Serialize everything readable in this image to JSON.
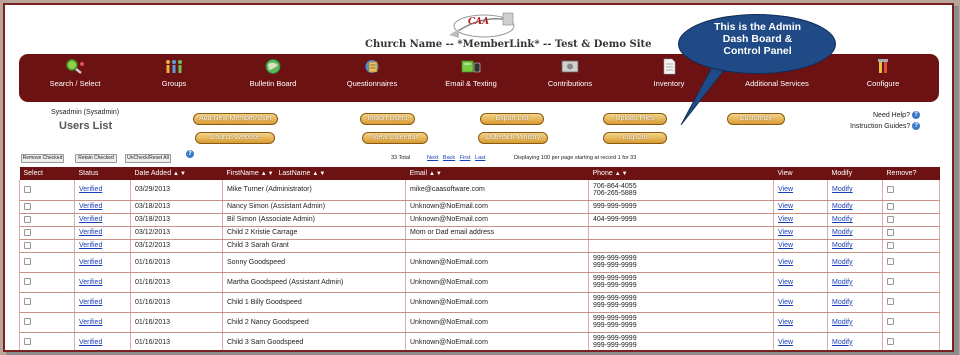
{
  "header": {
    "logo_text": "CAA",
    "site_title": "Church Name -- *MemberLink* -- Test & Demo Site"
  },
  "callout": {
    "line1": "This is the Admin",
    "line2": "Dash Board &",
    "line3": "Control Panel"
  },
  "nav": [
    {
      "label": "Search / Select",
      "icon": "search-icon"
    },
    {
      "label": "Groups",
      "icon": "people-icon"
    },
    {
      "label": "Bulletin Board",
      "icon": "globe-icon"
    },
    {
      "label": "Questionnaires",
      "icon": "clipboard-icon"
    },
    {
      "label": "Email & Texting",
      "icon": "email-icon"
    },
    {
      "label": "Contributions",
      "icon": "money-icon"
    },
    {
      "label": "Inventory",
      "icon": "document-icon"
    },
    {
      "label": "Additional Services",
      "icon": "services-icon"
    },
    {
      "label": "Configure",
      "icon": "tools-icon"
    }
  ],
  "user": {
    "name": "Sysadmin (Sysadmin)",
    "page_title": "Users List"
  },
  "actions": {
    "add_member": "Add New Member/User",
    "import_users": "Import Users",
    "export_list": "Export List",
    "upload_files": "Upload Files",
    "customize": "Customize",
    "church_website": "Church Website",
    "view_calendar": "View Calendar",
    "outreach_ministry": "Outreach Ministry",
    "log_out": "Log Out"
  },
  "help": {
    "need_help": "Need Help?",
    "instruction_guides": "Instruction Guides?"
  },
  "list_controls": {
    "remove_checked": "Remove Checked",
    "retain_checked": "Retain Checked",
    "uncheck_reset": "UnCheck/Reset All",
    "total": "33 Total",
    "next": "Next",
    "back": "Back",
    "first": "First",
    "last": "Last",
    "display_info": "Displaying 100 per page starting at record 1 for 33"
  },
  "table": {
    "headers": {
      "select": "Select",
      "status": "Status",
      "date_added": "Date Added",
      "first_name": "FirstName",
      "last_name": "LastName",
      "email": "Email",
      "phone": "Phone",
      "view": "View",
      "modify": "Modify",
      "remove": "Remove?"
    },
    "rows": [
      {
        "status": "Verified",
        "date": "03/29/2013",
        "name": "Mike Turner (Administrator)",
        "email": "mike@caasoftware.com",
        "phone1": "706-864-4055",
        "phone2": "706-265-5889",
        "view": "View",
        "modify": "Modify"
      },
      {
        "status": "Verified",
        "date": "03/18/2013",
        "name": "Nancy Simon (Assistant Admin)",
        "email": "Unknown@NoEmail.com",
        "phone1": "999-999-9999",
        "phone2": "",
        "view": "View",
        "modify": "Modify"
      },
      {
        "status": "Verified",
        "date": "03/18/2013",
        "name": "Bil Simon (Associate Admin)",
        "email": "Unknown@NoEmail.com",
        "phone1": "404-999-9999",
        "phone2": "",
        "view": "View",
        "modify": "Modify"
      },
      {
        "status": "Verified",
        "date": "03/12/2013",
        "name": "Child 2 Kristie Carrage",
        "email": "Mom or Dad email address",
        "phone1": "",
        "phone2": "",
        "view": "View",
        "modify": "Modify"
      },
      {
        "status": "Verified",
        "date": "03/12/2013",
        "name": "Child 3 Sarah Grant",
        "email": "",
        "phone1": "",
        "phone2": "",
        "view": "View",
        "modify": "Modify"
      },
      {
        "status": "Verified",
        "date": "01/16/2013",
        "name": "Sonny Goodspeed",
        "email": "Unknown@NoEmail.com",
        "phone1": "999-999-9999",
        "phone2": "999-999-9999",
        "view": "View",
        "modify": "Modify"
      },
      {
        "status": "Verified",
        "date": "01/16/2013",
        "name": "Martha Goodspeed (Assistant Admin)",
        "email": "Unknown@NoEmail.com",
        "phone1": "999-999-9999",
        "phone2": "999-999-9999",
        "view": "View",
        "modify": "Modify"
      },
      {
        "status": "Verified",
        "date": "01/16/2013",
        "name": "Child 1 Billy Goodspeed",
        "email": "Unknown@NoEmail.com",
        "phone1": "999-999-9999",
        "phone2": "999-999-9999",
        "view": "View",
        "modify": "Modify"
      },
      {
        "status": "Verified",
        "date": "01/16/2013",
        "name": "Child 2 Nancy Goodspeed",
        "email": "Unknown@NoEmail.com",
        "phone1": "999-999-9999",
        "phone2": "999-999-9999",
        "view": "View",
        "modify": "Modify"
      },
      {
        "status": "Verified",
        "date": "01/16/2013",
        "name": "Child 3 Sam Goodspeed",
        "email": "Unknown@NoEmail.com",
        "phone1": "999-999-9999",
        "phone2": "999-999-9999",
        "view": "View",
        "modify": "Modify"
      }
    ]
  },
  "colors": {
    "brand_dark_red": "#6d1212",
    "button_gold": "#d89b33",
    "link_blue": "#1a3fb5",
    "callout_blue": "#1f4a85"
  }
}
